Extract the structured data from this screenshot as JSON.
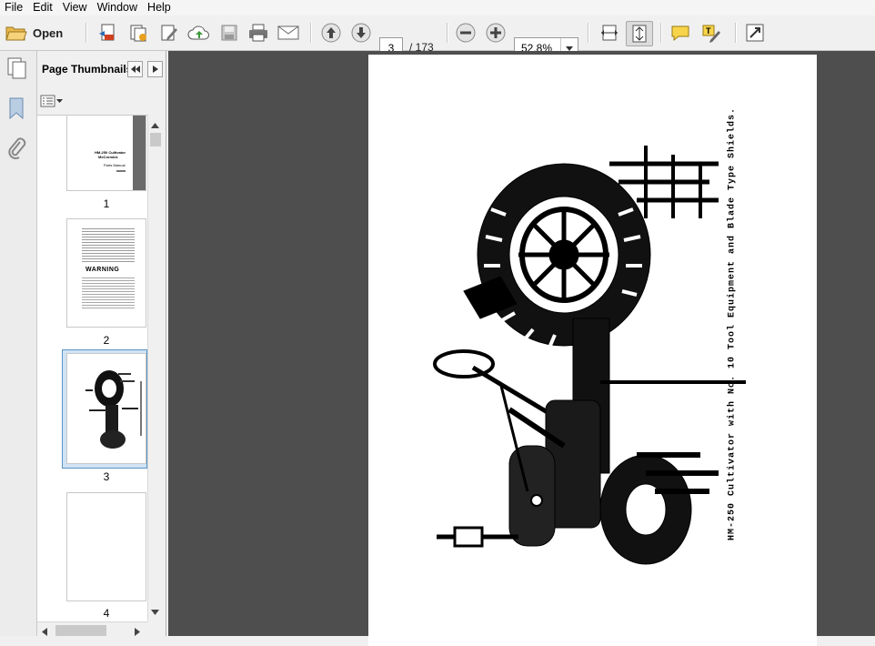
{
  "menu": [
    "File",
    "Edit",
    "View",
    "Window",
    "Help"
  ],
  "toolbar": {
    "open_label": "Open",
    "current_page": "3",
    "total_pages": "/ 173",
    "zoom": "52.8%"
  },
  "panel": {
    "title": "Page Thumbnails",
    "thumbnails": [
      {
        "label": "1",
        "lines": [
          "HM-250 Cultivator",
          "McCormick",
          "Parts Manual"
        ]
      },
      {
        "label": "2",
        "warning": "WARNING"
      },
      {
        "label": "3"
      },
      {
        "label": "4"
      }
    ]
  },
  "document": {
    "caption": "HM-250 Cultivator with No. 10 Tool Equipment and Blade Type Shields."
  },
  "icons": {
    "toolbar": [
      "open-folder-icon",
      "create-pdf-icon",
      "combine-files-icon",
      "edit-pdf-icon",
      "upload-cloud-icon",
      "save-icon",
      "print-icon",
      "email-icon",
      "previous-page-icon",
      "next-page-icon",
      "zoom-out-icon",
      "zoom-in-icon",
      "fit-width-icon",
      "fit-page-icon",
      "comment-icon",
      "highlight-icon",
      "full-screen-icon"
    ],
    "leftstrip": [
      "pages-icon",
      "bookmarks-icon",
      "attachments-icon"
    ]
  }
}
